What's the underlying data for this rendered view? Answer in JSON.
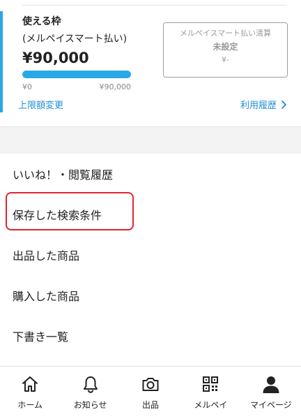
{
  "credit": {
    "title": "使える枠",
    "subtitle": "(メルペイスマート払い)",
    "amount": "¥90,000",
    "progress_fraction": 1.0,
    "min_label": "¥0",
    "max_label": "¥90,000",
    "settlement_title": "メルペイスマート払い清算",
    "settlement_status": "未設定",
    "settlement_amount": "¥-",
    "change_limit_label": "上限額変更",
    "usage_history_label": "利用履歴"
  },
  "menu": {
    "items": [
      {
        "label": "いいね！・閲覧履歴"
      },
      {
        "label": "保存した検索条件"
      },
      {
        "label": "出品した商品"
      },
      {
        "label": "購入した商品"
      },
      {
        "label": "下書き一覧"
      }
    ]
  },
  "bottom_nav": {
    "items": [
      {
        "label": "ホーム",
        "icon": "home-icon"
      },
      {
        "label": "お知らせ",
        "icon": "bell-icon"
      },
      {
        "label": "出品",
        "icon": "camera-icon"
      },
      {
        "label": "メルペイ",
        "icon": "qr-code-icon"
      },
      {
        "label": "マイページ",
        "icon": "person-icon"
      }
    ]
  },
  "colors": {
    "accent": "#29a8e8",
    "link": "#1e8fd8",
    "highlight": "#e1242f"
  }
}
